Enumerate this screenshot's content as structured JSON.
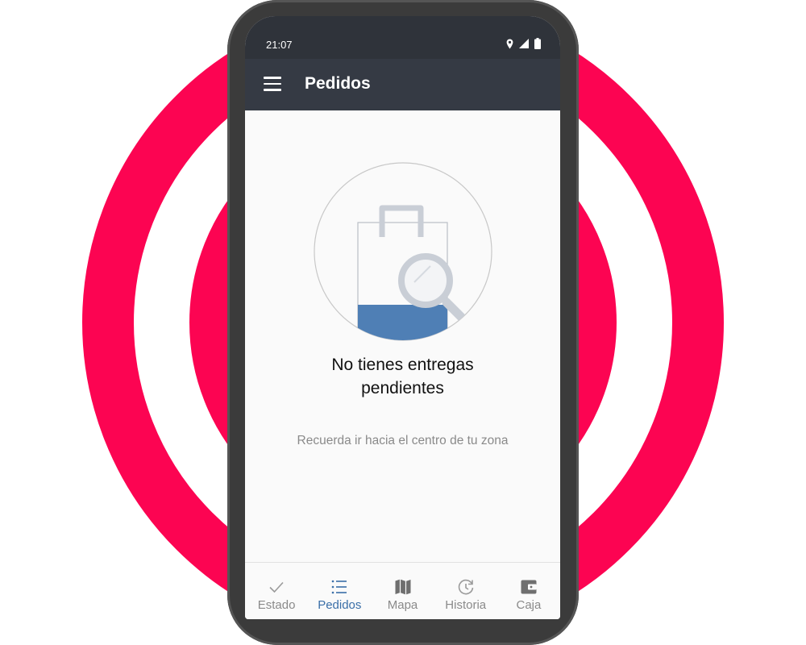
{
  "colors": {
    "ring": "#fc0452",
    "phone_frame": "#3b3b3b",
    "statusbar": "#2f333a",
    "appbar": "#353a44",
    "screen_bg": "#fafafa",
    "accent": "#3a6fa8",
    "bag_fill": "#4f7fb5",
    "inactive": "#8a8a8a"
  },
  "status_bar": {
    "time": "21:07",
    "icons": [
      "location-icon",
      "signal-icon",
      "battery-icon"
    ]
  },
  "app_bar": {
    "menu_icon": "hamburger-menu-icon",
    "title": "Pedidos"
  },
  "empty_state": {
    "illustration_icon": "shopping-bag-search-icon",
    "title_line1": "No tienes entregas",
    "title_line2": "pendientes",
    "hint": "Recuerda ir hacia el centro de tu zona"
  },
  "bottom_nav": {
    "active": "Pedidos",
    "items": [
      {
        "label": "Estado",
        "icon": "check-icon"
      },
      {
        "label": "Pedidos",
        "icon": "list-icon"
      },
      {
        "label": "Mapa",
        "icon": "map-icon"
      },
      {
        "label": "Historia",
        "icon": "history-icon"
      },
      {
        "label": "Caja",
        "icon": "wallet-icon"
      }
    ]
  }
}
